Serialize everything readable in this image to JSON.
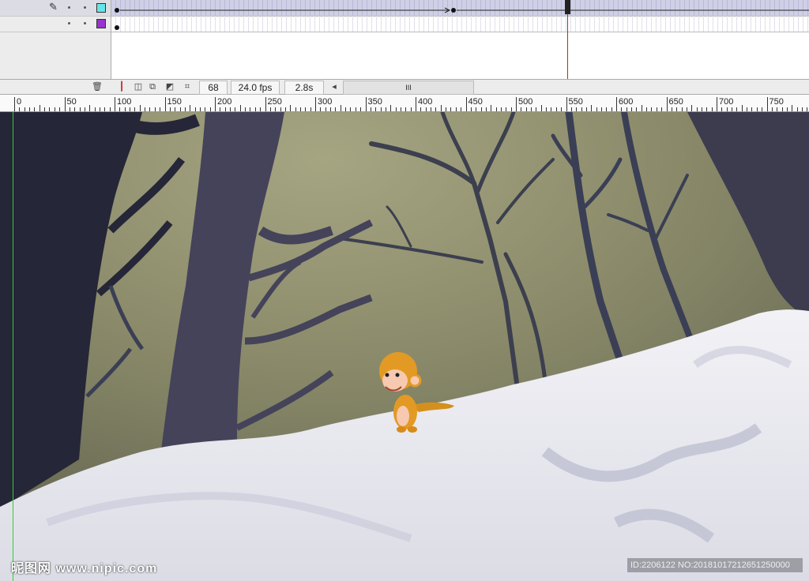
{
  "timeline": {
    "layers": [
      {
        "pencil_icon": "pencil-icon",
        "swatch_color": "#66e6e6"
      },
      {
        "swatch_color": "#9933cc"
      }
    ],
    "status": {
      "current_frame": "68",
      "frame_rate": "24.0 fps",
      "elapsed_time": "2.8s",
      "scroll_grip": "III"
    },
    "playhead_color": "#cc2222"
  },
  "ruler": {
    "labels": [
      "0",
      "50",
      "100",
      "150",
      "200",
      "250",
      "300",
      "350",
      "400",
      "450",
      "500",
      "550",
      "600",
      "650",
      "700",
      "750"
    ]
  },
  "watermark": {
    "left": "昵图网 www.nipic.com",
    "right": "ID:2206122 NO:20181017212651250000"
  }
}
